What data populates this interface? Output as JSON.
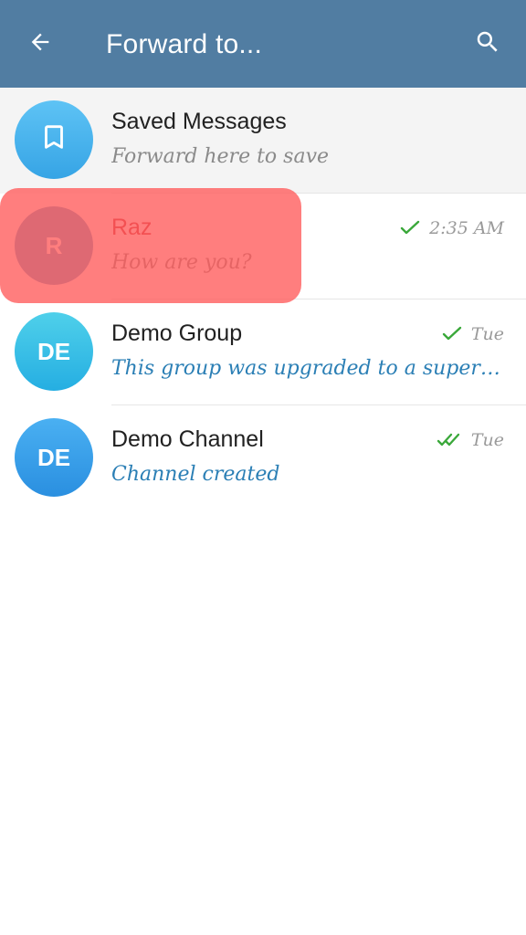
{
  "app": {
    "title": "Forward to..."
  },
  "icons": {
    "back": "arrow-left-icon",
    "search": "search-icon",
    "saved": "bookmark-icon",
    "single_check": "check-icon",
    "double_check": "double-check-icon"
  },
  "colors": {
    "header": "#517da2",
    "accent": "#2b7fb5",
    "check": "#3aa83a",
    "highlight": "#ff5a5a"
  },
  "chats": [
    {
      "name": "Saved Messages",
      "preview": "Forward here to save",
      "avatar_text": "",
      "time": ""
    },
    {
      "name": "Raz",
      "preview": "How are you?",
      "avatar_text": "R",
      "time": "2:35 AM"
    },
    {
      "name": "Demo Group",
      "preview": "This group was upgraded to a super…",
      "avatar_text": "DE",
      "time": "Tue"
    },
    {
      "name": "Demo Channel",
      "preview": "Channel created",
      "avatar_text": "DE",
      "time": "Tue"
    }
  ]
}
